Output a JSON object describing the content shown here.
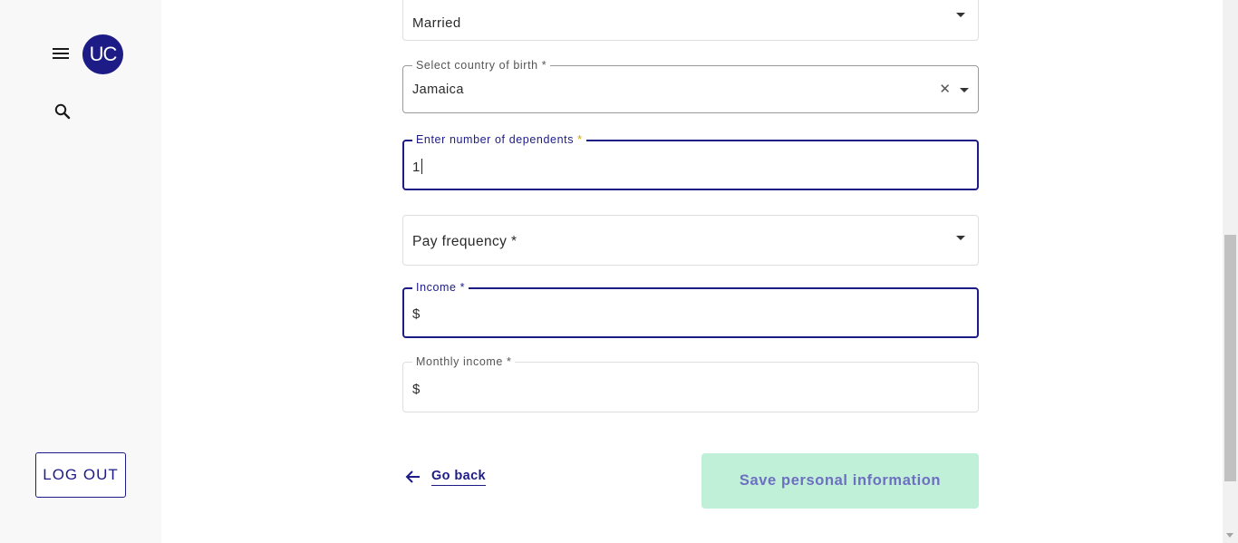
{
  "sidebar": {
    "avatar_initials": "UC",
    "menu_icon": "hamburger-menu-icon",
    "search_icon": "search-icon",
    "logout_label": "LOG OUT"
  },
  "form": {
    "marital_status": {
      "value": "Married"
    },
    "country_of_birth": {
      "label": "Select country of birth *",
      "value": "Jamaica"
    },
    "dependents": {
      "label": "Enter number of dependents",
      "required_mark": "*",
      "value": "1"
    },
    "pay_frequency": {
      "placeholder": "Pay frequency *"
    },
    "income": {
      "label": "Income *",
      "prefix": "$"
    },
    "monthly_income": {
      "label": "Monthly income *",
      "prefix": "$"
    }
  },
  "actions": {
    "go_back_label": "Go back",
    "save_label": "Save personal information"
  },
  "colors": {
    "brand": "#1d1b86",
    "save_button_bg": "#c1f0d9",
    "save_button_text": "#6d6fc0",
    "required_accent": "#d9a400"
  }
}
